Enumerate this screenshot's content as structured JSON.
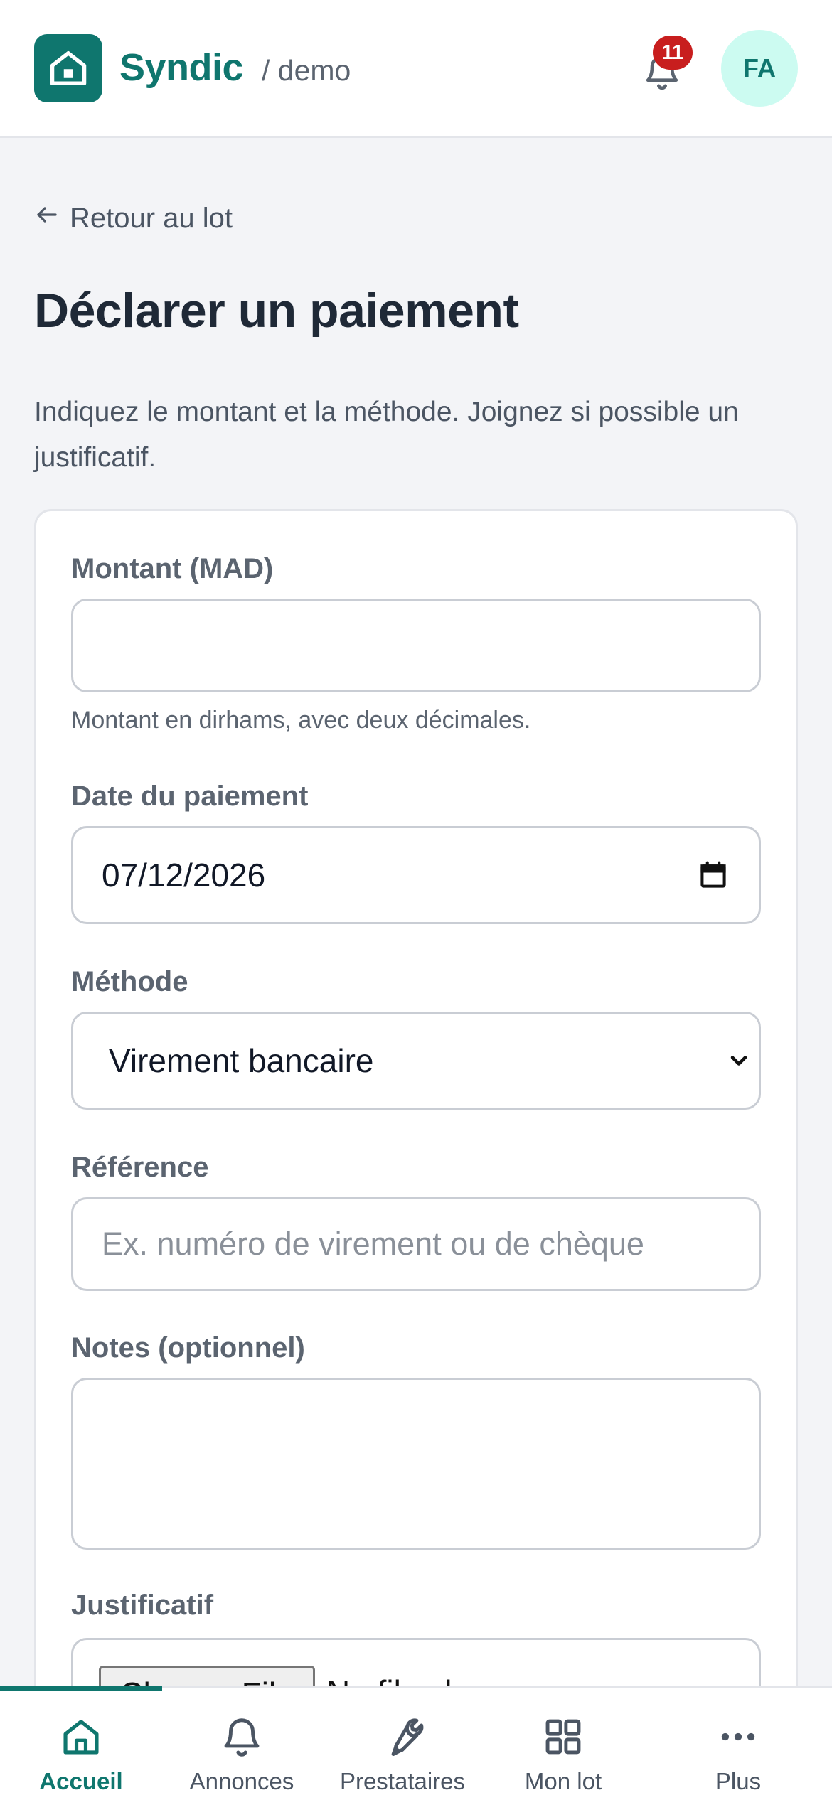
{
  "header": {
    "brand": "Syndic",
    "workspace": "/ demo",
    "notifications_count": "11",
    "avatar_initials": "FA"
  },
  "page": {
    "back_link": "Retour au lot",
    "title": "Déclarer un paiement",
    "subtitle": "Indiquez le montant et la méthode. Joignez si possible un justificatif."
  },
  "form": {
    "amount": {
      "label": "Montant (MAD)",
      "value": "",
      "hint": "Montant en dirhams, avec deux décimales."
    },
    "date": {
      "label": "Date du paiement",
      "value": "07/12/2026"
    },
    "method": {
      "label": "Méthode",
      "selected": "Virement bancaire"
    },
    "reference": {
      "label": "Référence",
      "placeholder": "Ex. numéro de virement ou de chèque"
    },
    "notes": {
      "label": "Notes (optionnel)",
      "value": ""
    },
    "attachment": {
      "label": "Justificatif",
      "button_label": "Choose File",
      "status": "No file chosen"
    }
  },
  "bottom_nav": {
    "items": [
      {
        "label": "Accueil",
        "icon": "home-icon",
        "active": true
      },
      {
        "label": "Annonces",
        "icon": "bell-icon"
      },
      {
        "label": "Prestataires",
        "icon": "wrench-icon"
      },
      {
        "label": "Mon lot",
        "icon": "grid-icon"
      },
      {
        "label": "Plus",
        "icon": "more-icon"
      }
    ]
  },
  "colors": {
    "brand": "#0f766e",
    "badge": "#c81e1e",
    "avatar_bg": "#ccfbf1",
    "page_bg": "#f3f4f7"
  }
}
